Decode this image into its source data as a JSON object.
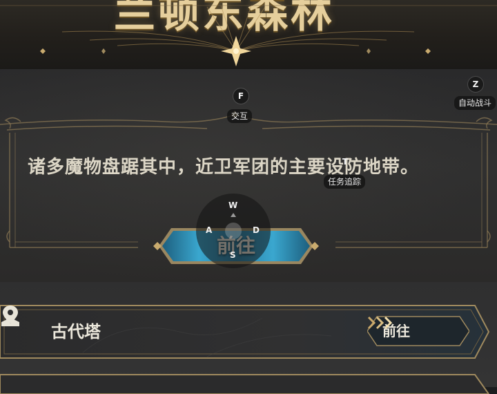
{
  "banner": {
    "title": "兰顿东森林"
  },
  "dialog": {
    "description": "诸多魔物盘踞其中，近卫军团的主要设防地带。",
    "go_button": "前往"
  },
  "hud": {
    "interact": {
      "key": "F",
      "label": "交互"
    },
    "auto_battle": {
      "key": "Z",
      "label": "自动战斗"
    },
    "quest_track": {
      "key": "T",
      "label": "任务追踪"
    },
    "joystick": {
      "up": "W",
      "left": "A",
      "right": "D",
      "down": "S"
    }
  },
  "locations": [
    {
      "name": "古代塔",
      "go_label": "前往",
      "icon": "map-pin-icon"
    }
  ],
  "colors": {
    "gold": "#c9ab6e",
    "button_blue": "#3aa7cf",
    "panel": "#2e2e2f"
  }
}
